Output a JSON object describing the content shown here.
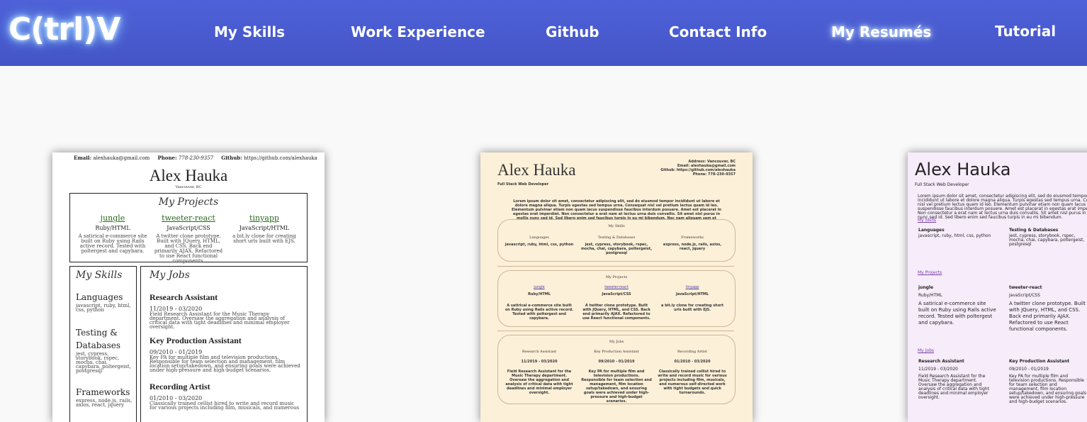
{
  "nav": {
    "logo": "C(trl)V",
    "links": [
      "My Skills",
      "Work Experience",
      "Github",
      "Contact Info",
      "My Resumés",
      "Tutorial"
    ]
  },
  "resume1": {
    "email_label": "Email:",
    "email": "alexhauka@gmail.com",
    "phone_label": "Phone:",
    "phone": "778-230-9357",
    "github_label": "Github:",
    "github": "https://github.com/alexhauka",
    "name": "Alex Hauka",
    "location": "Vancouver, BC",
    "projects_title": "My Projects",
    "projects": [
      {
        "name": "jungle",
        "tech": "Ruby/HTML",
        "desc": "A satirical e-commerce site built on Ruby using Rails active record. Tested with poltergest and capybara."
      },
      {
        "name": "tweeter-react",
        "tech": "JavaScript/CSS",
        "desc": "A twitter clone prototype. Built with JQuery, HTML, and CSS. Back end primarily AJAX. Refactored to use React functional components."
      },
      {
        "name": "tinyapp",
        "tech": "JavaScript/HTML",
        "desc": "a bit.ly clone for creating short urls built with EJS."
      }
    ],
    "skills_title": "My Skills",
    "skills": [
      {
        "heading": "Languages",
        "value": "javascript, ruby, html, css, python"
      },
      {
        "heading": "Testing & Databases",
        "value": "jest, cypress, storybook, rspec, mocha, chai, capybara, poltergeist, postgresql"
      },
      {
        "heading": "Frameworks",
        "value": "express, node.js, rails, axios, react, jquery"
      }
    ],
    "jobs_title": "My Jobs",
    "jobs": [
      {
        "title": "Research Assistant",
        "dates": "11/2019 - 03/2020",
        "desc": "Field Research Assistant for the Music Therapy department. Oversaw the aggregation and analysis of critical data with tight deadlines and minimal employer oversight."
      },
      {
        "title": "Key Production Assistant",
        "dates": "09/2010 - 01/2019",
        "desc": "Key PA for multiple film and television productions. Responsible for team selection and management, film location setup/takedown, and ensuring goals were achieved under high-pressure and high-budget scenarios."
      },
      {
        "title": "Recording Artist",
        "dates": "01/2010 - 03/2020",
        "desc": "Classically trained cellist hired to write and record music for various projects including film, musicals, and numerous"
      }
    ]
  },
  "resume2": {
    "name": "Alex Hauka",
    "role": "Full Stack Web Developer",
    "contact": [
      "Address: Vancouver, BC",
      "Email: alexhauka@gmail.com",
      "Github: https://github.com/alexhauka",
      "Phone: 778-230-9357"
    ],
    "lorem": "Lorem ipsum dolor sit amet, consectetur adipiscing elit, sed do eiusmod tempor incididunt ut labore et dolore magna aliqua. Turpis egestas sed tempus urna. Consequat nisl vel pretium lectus quam id leo. Elementum pulvinar etiam non quam lacus suspendisse faucibus interdum posuere. Amet est placerat in egestas erat imperdiet. Non consectetur a erat nam at lectus urna duis convallis. Sit amet nisl purus in mollis nunc sed id. Sed libero enim sed faucibus turpis in eu mi bibendum. Nec nam aliquam sem et",
    "skills_title": "My Skills",
    "skills": [
      {
        "heading": "Languages",
        "value": "javascript, ruby, html, css, python"
      },
      {
        "heading": "Testing & Databases",
        "value": "jest, cypress, storybook, rspec, mocha, chai, capybara, poltergeist, postgresql"
      },
      {
        "heading": "Frameworks",
        "value": "express, node.js, rails, axios, react, jquery"
      }
    ],
    "projects_title": "My Projects",
    "projects": [
      {
        "name": "jungle",
        "tech": "Ruby/HTML",
        "desc": "A satirical e-commerce site built on Ruby using Rails active record. Tested with poltergest and capybara."
      },
      {
        "name": "tweeter-react",
        "tech": "JavaScript/CSS",
        "desc": "A twitter clone prototype. Built with JQuery, HTML, and CSS. Back end primarily AJAX. Refactored to use React functional components."
      },
      {
        "name": "tinyapp",
        "tech": "JavaScript/HTML",
        "desc": "a bit.ly clone for creating short urls built with EJS."
      }
    ],
    "jobs_title": "My Jobs",
    "jobs": [
      {
        "title": "Research Assistant",
        "dates": "11/2019 - 03/2020",
        "desc": "Field Research Assistant for the Music Therapy department. Oversaw the aggregation and analysis of critical data with tight deadlines and minimal employer oversight."
      },
      {
        "title": "Key Production Assistant",
        "dates": "09/2010 - 01/2019",
        "desc": "Key PA for multiple film and television productions. Responsible for team selection and management, film location setup/takedown, and ensuring goals were achieved under high-pressure and high-budget scenarios."
      },
      {
        "title": "Recording Artist",
        "dates": "01/2010 - 03/2020",
        "desc": "Classically trained cellist hired to write and record music for various projects including film, musicals, and numerous self-directed work with tight budgets and quick turnarounds."
      }
    ]
  },
  "resume3": {
    "name": "Alex Hauka",
    "role": "Full Stack Web Developer",
    "lorem": "Lorem ipsum dolor sit amet, consectetur adipiscing elit, sed do eiusmod tempor incididunt ut labore et dolore magna aliqua. Turpis egestas sed tempus urna. Consequat nisl vel pretium lectus quam id leo. Elementum pulvinar etiam non quam lacus suspendisse faucibus interdum posuere. Amet est placerat in egestas erat imperdiet. Non consectetur a erat nam at lectus urna duis convallis. Sit amet nisl purus in mollis nunc sed id. Sed libero enim sed faucibus turpis in eu mi bibendum.",
    "skills_title": "My Skills",
    "skills": [
      {
        "heading": "Languages",
        "value": "javascript, ruby, html, css, python"
      },
      {
        "heading": "Testing & Databases",
        "value": "jest, cypress, storybook, rspec, mocha, chai, capybara, poltergeist, postgresql"
      }
    ],
    "projects_title": "My Projects",
    "projects": [
      {
        "name": "jungle",
        "tech": "Ruby/HTML",
        "desc": "A satirical e-commerce site built on Ruby using Rails active record. Tested with poltergest and capybara."
      },
      {
        "name": "tweeter-react",
        "tech": "JavaScript/CSS",
        "desc": "A twitter clone prototype. Built with JQuery, HTML, and CSS. Back end primarily AJAX. Refactored to use React functional components."
      }
    ],
    "jobs_title": "My Jobs",
    "jobs": [
      {
        "title": "Research Assistant",
        "dates": "11/2019 - 03/2020",
        "desc": "Field Research Assistant for the Music Therapy department. Oversaw the aggregation and analysis of critical data with tight deadlines and minimal employer oversight."
      },
      {
        "title": "Key Production Assistant",
        "dates": "09/2010 - 01/2019",
        "desc": "Key PA for multiple film and television productions. Responsible for team selection and management, film location setup/takedown, and ensuring goals were achieved under high-pressure and high-budget scenarios."
      }
    ]
  }
}
